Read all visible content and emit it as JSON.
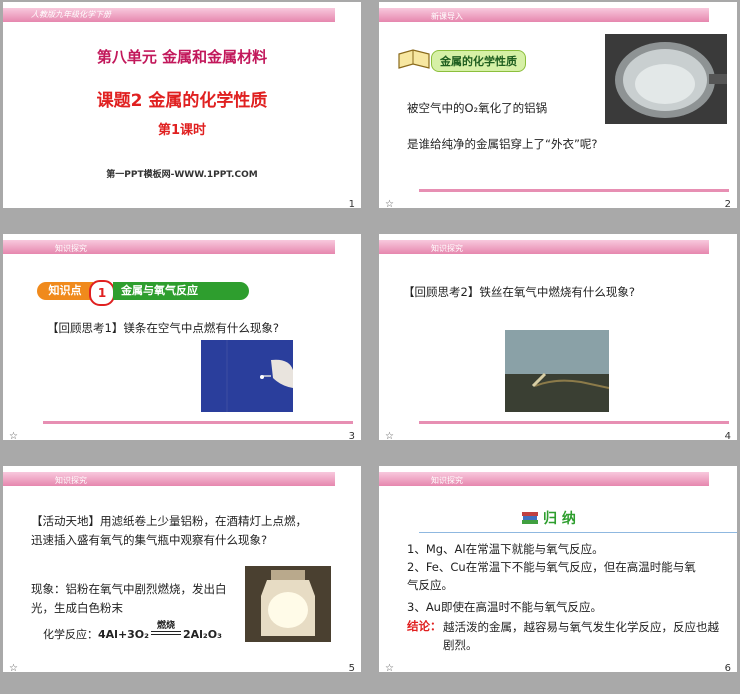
{
  "slides": [
    {
      "number": "1",
      "header": "人教版九年级化学下册",
      "unit": "第八单元  金属和金属材料",
      "lesson": "课题2  金属的化学性质",
      "period": "第1课时",
      "site": "第一PPT模板网-WWW.1PPT.COM"
    },
    {
      "number": "2",
      "nav": "新课导入",
      "book_label": "金属的化学性质",
      "caption": "被空气中的O₂氧化了的铝锅",
      "question": "是谁给纯净的金属铝穿上了“外衣”呢?"
    },
    {
      "number": "3",
      "nav": "知识探究",
      "badge": "知识点",
      "badge_num": "1",
      "topic": "金属与氧气反应",
      "question": "【回顾思考1】镁条在空气中点燃有什么现象?"
    },
    {
      "number": "4",
      "nav": "知识探究",
      "question": "【回顾思考2】铁丝在氧气中燃烧有什么现象?"
    },
    {
      "number": "5",
      "nav": "知识探究",
      "activity": "【活动天地】用滤纸卷上少量铝粉，在酒精灯上点燃，迅速插入盛有氧气的集气瓶中观察有什么现象?",
      "observation": "现象：铝粉在氧气中剧烈燃烧，发出白光，生成白色粉末",
      "reaction_label": "化学反应：",
      "reaction_left": "4Al+3O₂",
      "reaction_cond": "燃烧",
      "reaction_right": "2Al₂O₃"
    },
    {
      "number": "6",
      "nav": "知识探究",
      "heading": "归  纳",
      "points": [
        "1、Mg、Al在常温下就能与氧气反应。",
        "2、Fe、Cu在常温下不能与氧气反应，但在高温时能与氧气反应。",
        "3、Au即使在高温时不能与氧气反应。"
      ],
      "conclusion_label": "结论：",
      "conclusion": "越活泼的金属，越容易与氧气发生化学反应，反应也越剧烈。"
    }
  ],
  "colors": {
    "accent_pink": "#e687ae",
    "title_red": "#e02020",
    "green": "#2e9e2e",
    "orange": "#f08a1c"
  }
}
